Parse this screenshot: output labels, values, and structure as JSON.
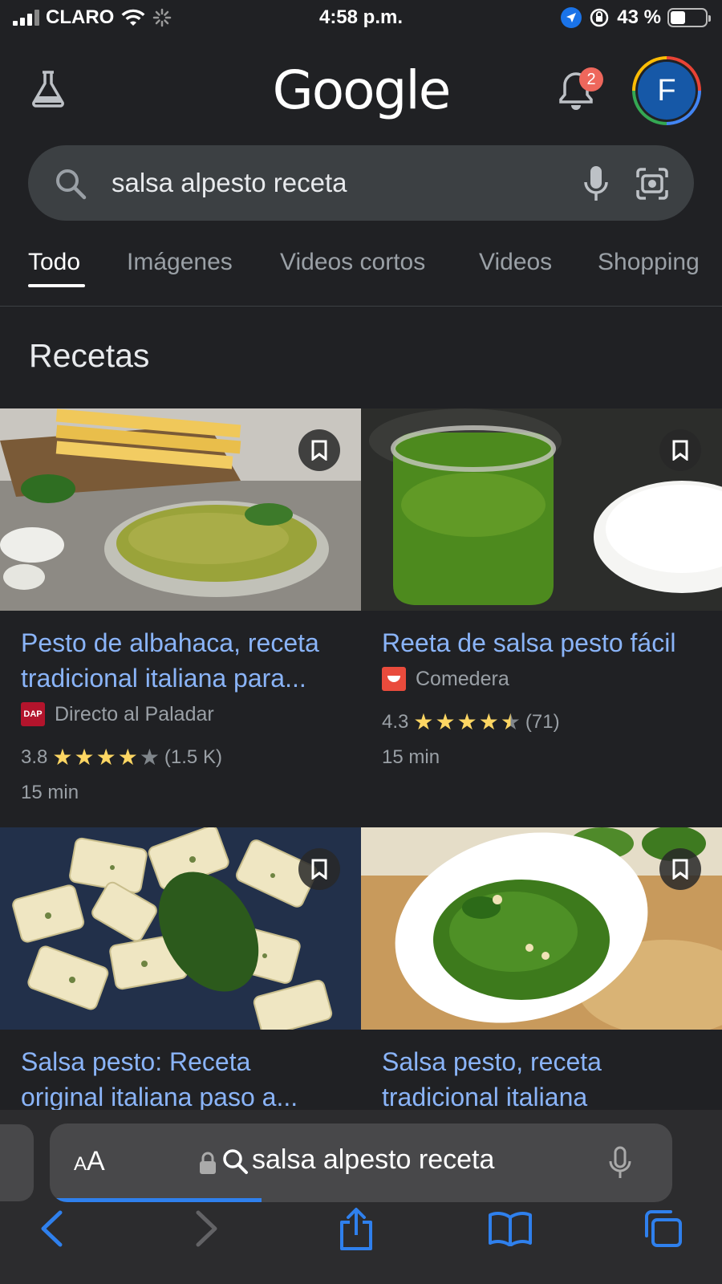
{
  "status_bar": {
    "carrier": "CLARO",
    "time": "4:58 p.m.",
    "battery": "43 %"
  },
  "header": {
    "logo": "Google",
    "notification_count": "2",
    "avatar_letter": "F"
  },
  "search": {
    "query": "salsa alpesto receta"
  },
  "tabs": [
    "Todo",
    "Imágenes",
    "Videos cortos",
    "Videos",
    "Shopping"
  ],
  "section_title": "Recetas",
  "recipes": [
    {
      "title": "Pesto de albahaca, receta tradicional italiana para...",
      "source": "Directo al Paladar",
      "source_logo": "DAP",
      "rating": "3.8",
      "reviews": "(1.5 K)",
      "time": "15 min",
      "stars": 3.8
    },
    {
      "title": "Reeta de salsa pesto fácil",
      "source": "Comedera",
      "rating": "4.3",
      "reviews": "(71)",
      "time": "15 min",
      "stars": 4.5
    },
    {
      "title": "Salsa pesto: Receta original italiana paso a..."
    },
    {
      "title": "Salsa pesto, receta tradicional italiana"
    }
  ],
  "safari": {
    "text_size_label": "AA",
    "url": "salsa alpesto receta",
    "load_progress": 0.34
  },
  "colors": {
    "background": "#202124",
    "link": "#8ab4f8",
    "star": "#fdd663",
    "safari_accent": "#2f80ed"
  }
}
